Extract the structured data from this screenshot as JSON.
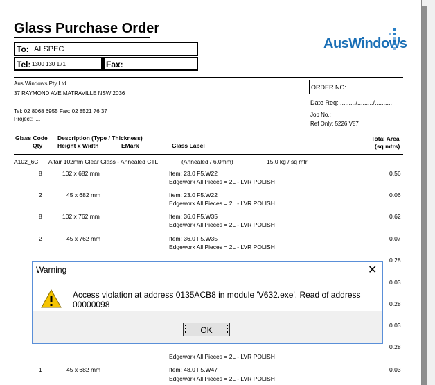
{
  "document": {
    "title": "Glass Purchase Order",
    "to_label": "To:",
    "to_value": "ALSPEC",
    "tel_label": "Tel:",
    "tel_value": "1300 130 171",
    "fax_label": "Fax:",
    "logo_text": "AusWindows",
    "company_name": "Aus Windows Pty Ltd",
    "company_address": "37 RAYMOND AVE MATRAVILLE  NSW 2036",
    "company_contact": "Tel: 02 8068 6955      Fax: 02 8521 76 37",
    "project": "Project:  ....",
    "order_no": "ORDER NO: ........................",
    "date_req": "Date Req:  ........./........./..........",
    "job_no": "Job No.:",
    "ref_only": "Ref Only: 5226 V87"
  },
  "table": {
    "h_glass_code": "Glass Code",
    "h_qty": "Qty",
    "h_description": "Description  (Type / Thickness)",
    "h_height_width": "Height  x  Width",
    "h_emark": "EMark",
    "h_glass_label": "Glass Label",
    "h_total_area": "Total Area",
    "h_sqm": "(sq mtrs)",
    "group_code": "A102_6C",
    "group_desc": "Altair 102mm Clear Glass - Annealed CTL",
    "group_type": "(Annealed / 6.0mm)",
    "group_weight": "15.0 kg / sq mtr",
    "rows": [
      {
        "qty": "8",
        "size": "102  x  682 mm",
        "item": "Item: 23.0     F5.W22",
        "edge": "Edgework All Pieces  = 2L - LVR  POLISH",
        "area": "0.56"
      },
      {
        "qty": "2",
        "size": "45  x  682 mm",
        "item": "Item: 23.0     F5.W22",
        "edge": "Edgework All Pieces  = 2L - LVR  POLISH",
        "area": "0.06"
      },
      {
        "qty": "8",
        "size": "102  x  762 mm",
        "item": "Item: 36.0     F5.W35",
        "edge": "Edgework All Pieces  = 2L - LVR  POLISH",
        "area": "0.62"
      },
      {
        "qty": "2",
        "size": "45  x  762 mm",
        "item": "Item: 36.0     F5.W35",
        "edge": "Edgework All Pieces  = 2L - LVR  POLISH",
        "area": "0.07"
      }
    ],
    "partial_row_area": "0.28",
    "hidden_areas": [
      "0.03",
      "0.28",
      "0.03",
      "0.28"
    ],
    "edge_after_dialog": "Edgework All Pieces  = 2L - LVR  POLISH",
    "last_row": {
      "qty": "1",
      "size": "45  x  682 mm",
      "item": "Item: 48.0     F5.W47",
      "edge": "Edgework All Pieces  = 2L - LVR  POLISH",
      "area": "0.03"
    }
  },
  "dialog": {
    "title": "Warning",
    "close_glyph": "✕",
    "message": "Access violation at address 0135ACB8 in module 'V632.exe'. Read of address 00000098",
    "ok_label": "OK"
  }
}
